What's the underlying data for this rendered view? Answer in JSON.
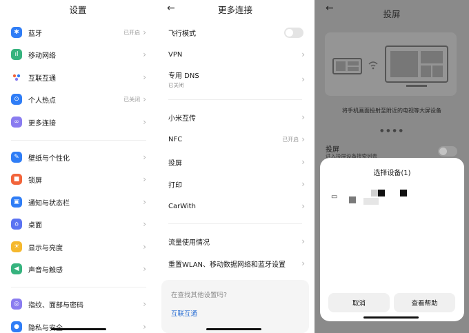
{
  "settings": {
    "title": "设置",
    "items": [
      {
        "label": "蓝牙",
        "status": "已开启",
        "color": "#2f7df6",
        "icon": "bluetooth-icon"
      },
      {
        "label": "移动网络",
        "status": "",
        "color": "#36b37e",
        "icon": "cellular-icon"
      },
      {
        "label": "互联互通",
        "status": "",
        "color": "#ffffff",
        "icon": "interconnect-icon"
      },
      {
        "label": "个人热点",
        "status": "已关闭",
        "color": "#2f7df6",
        "icon": "hotspot-icon"
      },
      {
        "label": "更多连接",
        "status": "",
        "color": "#8a7cf0",
        "icon": "link-icon"
      },
      {
        "label": "壁纸与个性化",
        "status": "",
        "color": "#2f7df6",
        "icon": "brush-icon"
      },
      {
        "label": "锁屏",
        "status": "",
        "color": "#f2643a",
        "icon": "lock-icon"
      },
      {
        "label": "通知与状态栏",
        "status": "",
        "color": "#2f7df6",
        "icon": "notification-icon"
      },
      {
        "label": "桌面",
        "status": "",
        "color": "#5b73f2",
        "icon": "home-icon"
      },
      {
        "label": "显示与亮度",
        "status": "",
        "color": "#f5b82e",
        "icon": "sun-icon"
      },
      {
        "label": "声音与触感",
        "status": "",
        "color": "#36b37e",
        "icon": "speaker-icon"
      },
      {
        "label": "指纹、面部与密码",
        "status": "",
        "color": "#8a7cf0",
        "icon": "fingerprint-icon"
      },
      {
        "label": "隐私与安全",
        "status": "",
        "color": "#2f7df6",
        "icon": "privacy-icon"
      }
    ]
  },
  "more": {
    "title": "更多连接",
    "items": [
      {
        "label": "飞行模式",
        "sub": "",
        "status": ""
      },
      {
        "label": "VPN",
        "sub": "",
        "status": ""
      },
      {
        "label": "专用 DNS",
        "sub": "已关闭",
        "status": ""
      },
      {
        "label": "小米互传",
        "sub": "",
        "status": ""
      },
      {
        "label": "NFC",
        "sub": "",
        "status": "已开启"
      },
      {
        "label": "投屏",
        "sub": "",
        "status": ""
      },
      {
        "label": "打印",
        "sub": "",
        "status": ""
      },
      {
        "label": "CarWith",
        "sub": "",
        "status": ""
      },
      {
        "label": "流量使用情况",
        "sub": "",
        "status": ""
      },
      {
        "label": "重置WLAN、移动数据网络和蓝牙设置",
        "sub": "",
        "status": ""
      }
    ],
    "card": {
      "question": "在查找其他设置吗?",
      "link": "互联互通"
    }
  },
  "cast": {
    "title": "投屏",
    "desc": "将手机画面投射至附近的电视等大屏设备",
    "row_title": "投屏",
    "row_sub": "进入投屏设备搜索列表",
    "sheet": {
      "title": "选择设备(1)",
      "cancel": "取消",
      "help": "查看帮助"
    }
  }
}
